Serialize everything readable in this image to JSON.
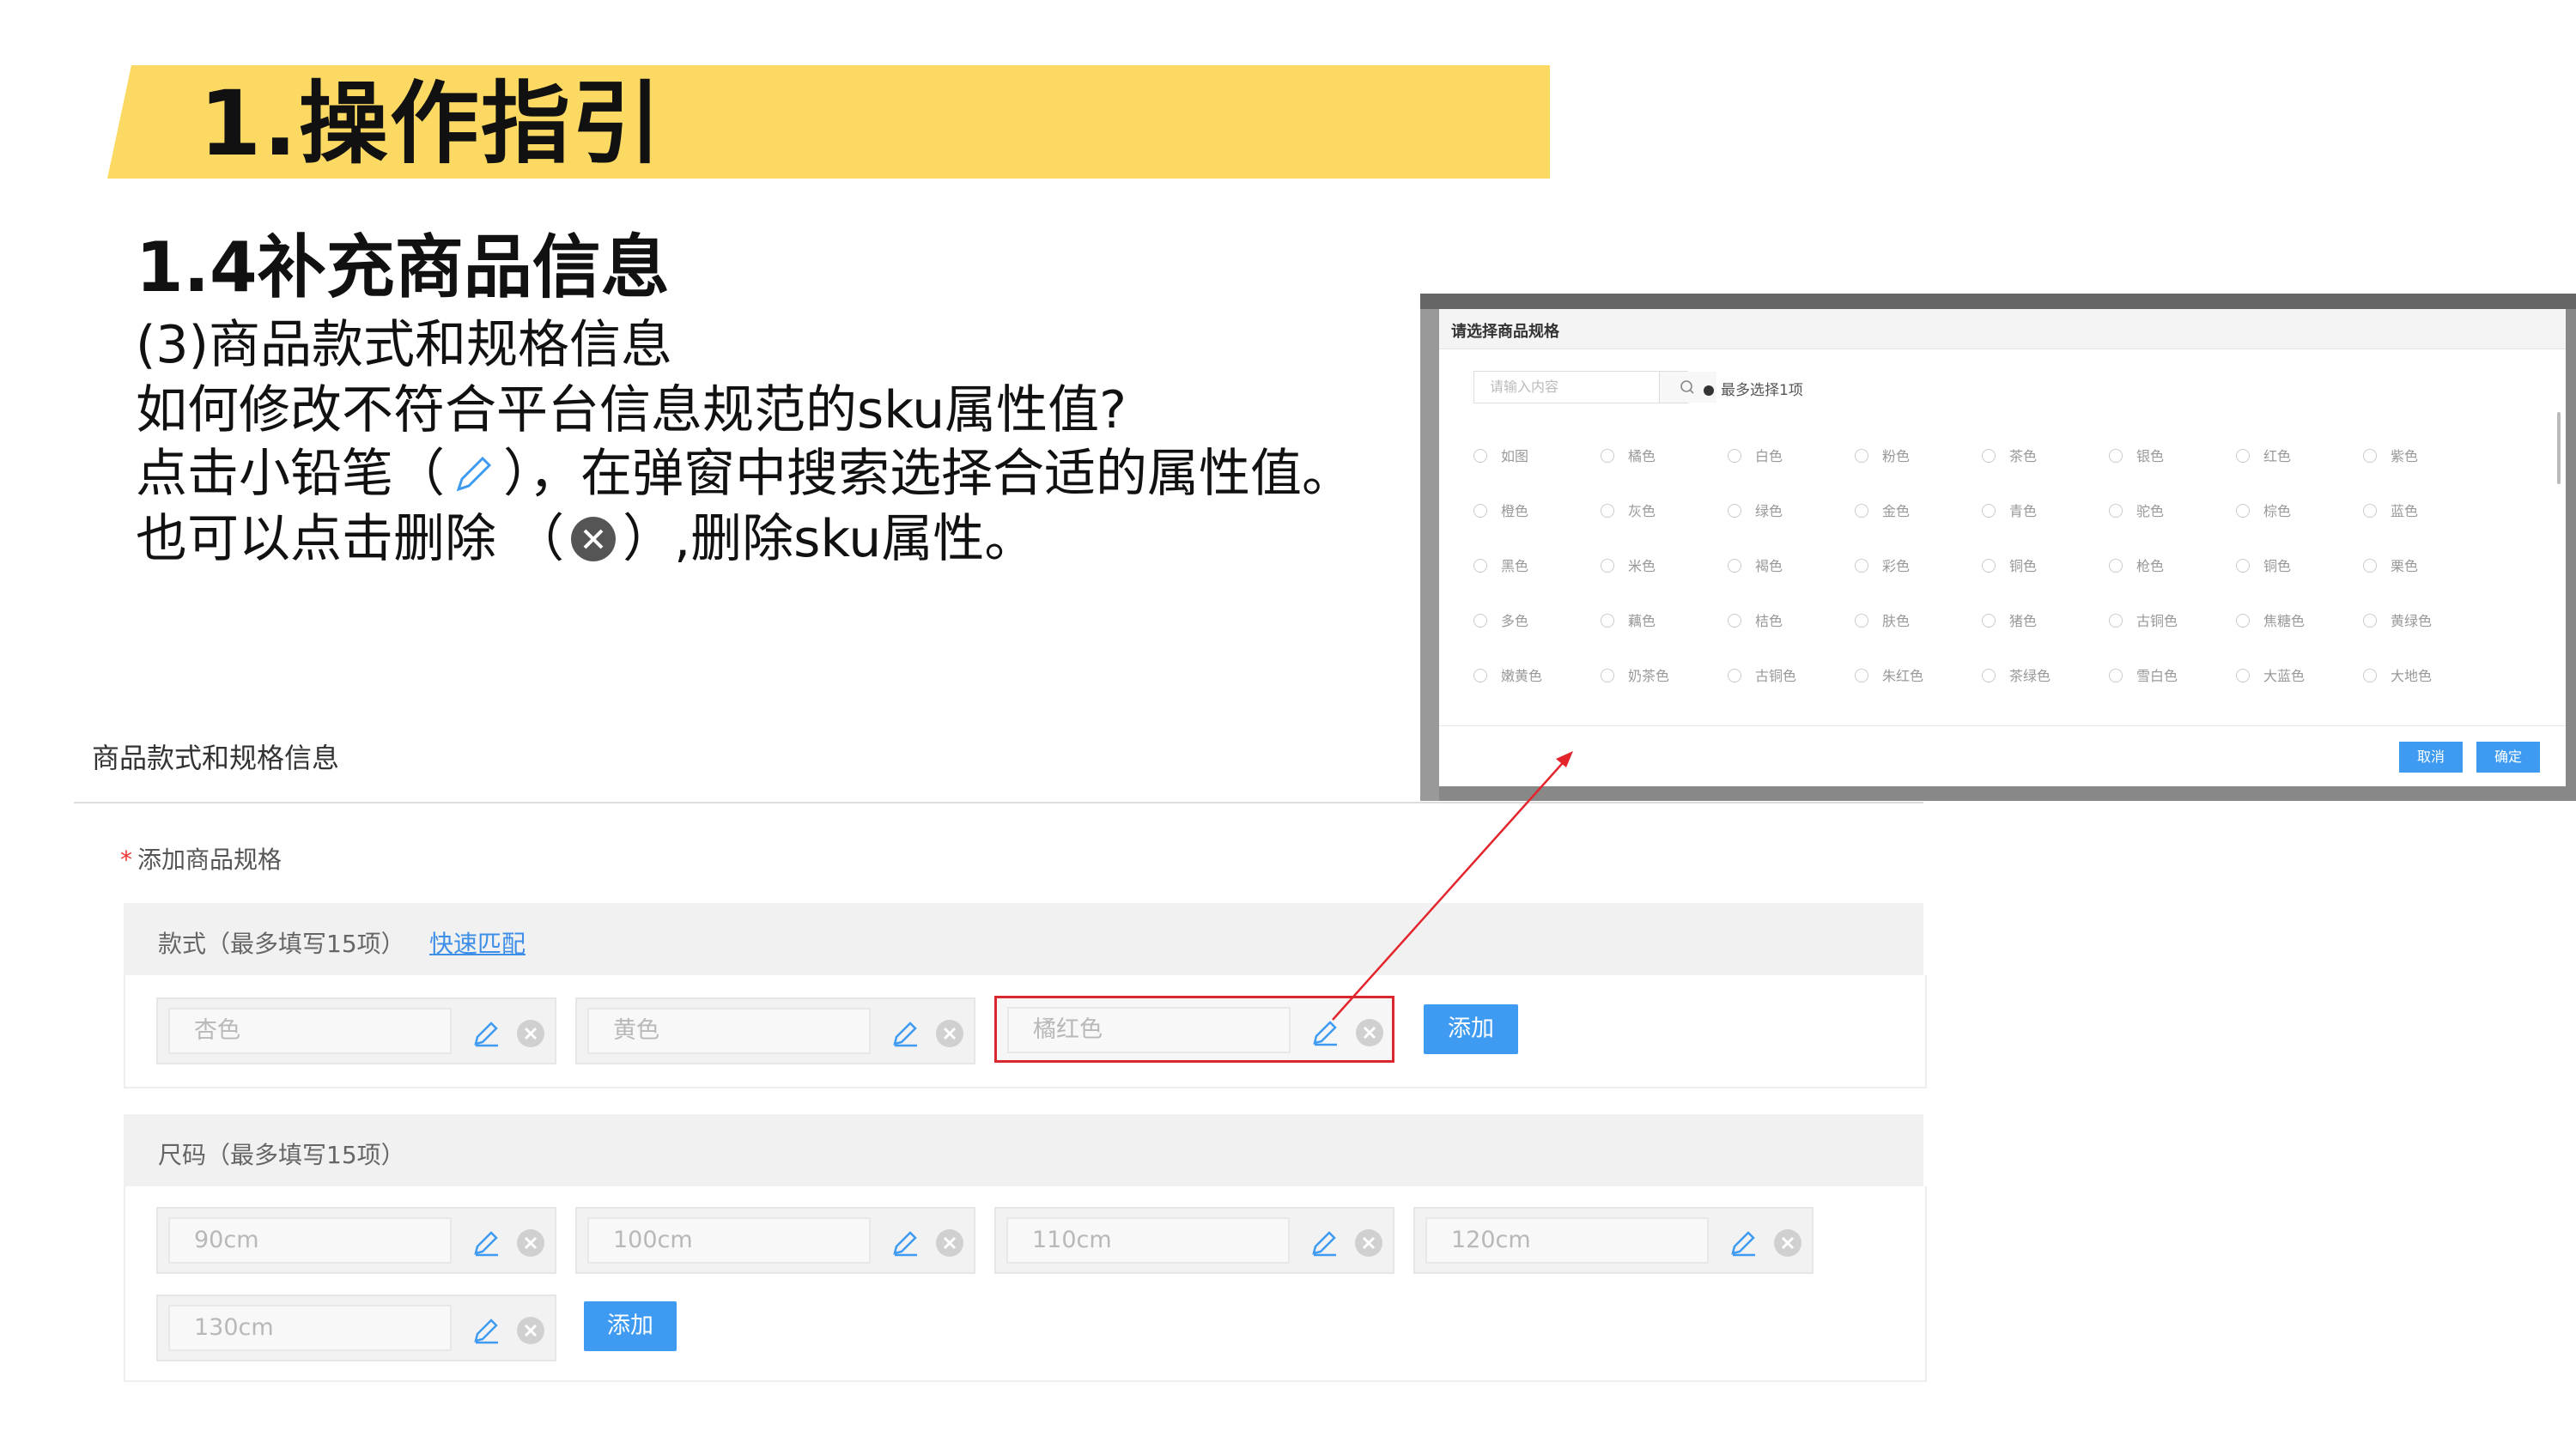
{
  "banner": {
    "title": "1.操作指引"
  },
  "instructions": {
    "subtitle": "1.4补充商品信息",
    "line1": "(3)商品款式和规格信息",
    "line2": "如何修改不符合平台信息规范的sku属性值?",
    "line3_pre": "点击小铅笔（",
    "line3_post": "），在弹窗中搜索选择合适的属性值。",
    "line4_pre": "也可以点击删除 （",
    "line4_post": "）,删除sku属性。"
  },
  "form": {
    "section_title": "商品款式和规格信息",
    "add_spec_label": "添加商品规格",
    "required_mark": "*",
    "style_group": {
      "label": "款式（最多填写15项）",
      "quick_match": "快速匹配",
      "items": [
        "杏色",
        "黄色",
        "橘红色"
      ],
      "add_label": "添加"
    },
    "size_group": {
      "label": "尺码（最多填写15项）",
      "items": [
        "90cm",
        "100cm",
        "110cm",
        "120cm",
        "130cm"
      ],
      "add_label": "添加"
    }
  },
  "modal": {
    "title": "请选择商品规格",
    "search_placeholder": "请输入内容",
    "hint": "最多选择1项",
    "rows": [
      [
        "如图",
        "橘色",
        "白色",
        "粉色",
        "茶色",
        "银色",
        "红色",
        "紫色"
      ],
      [
        "橙色",
        "灰色",
        "绿色",
        "金色",
        "青色",
        "驼色",
        "棕色",
        "蓝色"
      ],
      [
        "黑色",
        "米色",
        "褐色",
        "彩色",
        "铜色",
        "枪色",
        "铜色",
        "栗色"
      ],
      [
        "多色",
        "藕色",
        "桔色",
        "肤色",
        "猪色",
        "古铜色",
        "焦糖色",
        "黄绿色"
      ],
      [
        "嫩黄色",
        "奶茶色",
        "古铜色",
        "朱红色",
        "茶绿色",
        "雪白色",
        "大蓝色",
        "大地色"
      ]
    ],
    "cancel_label": "取消",
    "confirm_label": "确定"
  },
  "colors": {
    "banner": "#fbd962",
    "primary_button": "#3e9bf1",
    "highlight_border": "#d9272e",
    "link": "#3d8ee8"
  }
}
